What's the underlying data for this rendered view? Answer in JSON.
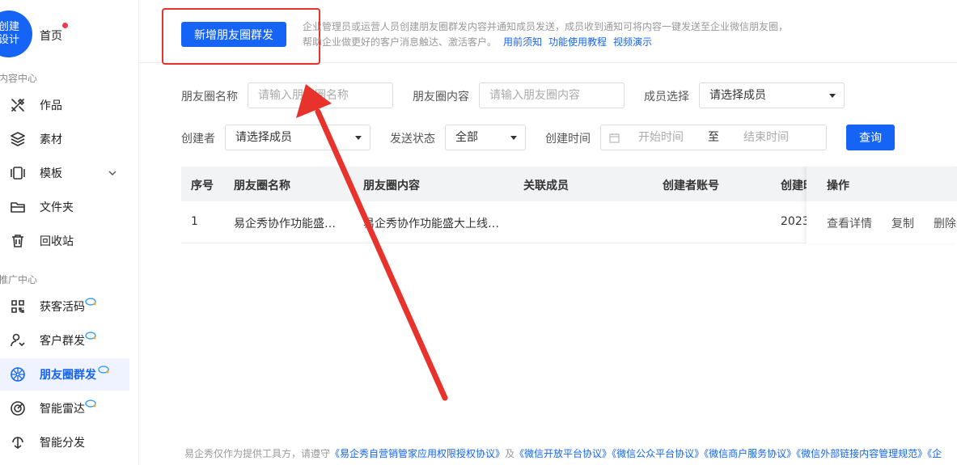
{
  "sidebar": {
    "logo_text": "创建\n设计",
    "home_label": "首页",
    "section_content": "内容中心",
    "section_promo": "推广中心",
    "items": [
      {
        "label": "作品",
        "icon": "tools-icon"
      },
      {
        "label": "素材",
        "icon": "layers-icon"
      },
      {
        "label": "模板",
        "icon": "template-icon"
      },
      {
        "label": "文件夹",
        "icon": "folder-icon"
      },
      {
        "label": "回收站",
        "icon": "trash-icon"
      },
      {
        "label": "获客活码",
        "icon": "qrcode-icon"
      },
      {
        "label": "客户群发",
        "icon": "user-broadcast-icon"
      },
      {
        "label": "朋友圈群发",
        "icon": "moments-icon"
      },
      {
        "label": "智能雷达",
        "icon": "radar-icon"
      },
      {
        "label": "智能分发",
        "icon": "distribute-icon"
      }
    ],
    "active_item": "朋友圈群发"
  },
  "topbar": {
    "add_button": "新增朋友圈群发",
    "desc_line1": "企业管理员或运营人员创建朋友圈群发内容并通知成员发送，成员收到通知可将内容一键发送至企业微信朋友圈，",
    "desc_line2": "帮助企业做更好的客户消息触达、激活客户。",
    "link1": "用前须知",
    "link2": "功能使用教程",
    "link3": "视频演示"
  },
  "filters": {
    "name_label": "朋友圈名称",
    "name_placeholder": "请输入朋友圈名称",
    "content_label": "朋友圈内容",
    "content_placeholder": "请输入朋友圈内容",
    "member_label": "成员选择",
    "member_value": "请选择成员",
    "creator_label": "创建者",
    "creator_value": "请选择成员",
    "status_label": "发送状态",
    "status_value": "全部",
    "time_label": "创建时间",
    "start_placeholder": "开始时间",
    "to_text": "至",
    "end_placeholder": "结束时间",
    "query_button": "查询"
  },
  "table": {
    "headers": [
      "序号",
      "朋友圈名称",
      "朋友圈内容",
      "关联成员",
      "创建者账号",
      "创建时",
      "操作"
    ],
    "rows": [
      {
        "index": "1",
        "name": "易企秀协作功能盛…",
        "content": "易企秀协作功能盛大上线…",
        "member": " ",
        "creator": "",
        "created": "2023",
        "ops": [
          "查看详情",
          "复制",
          "删除"
        ]
      }
    ]
  },
  "footer": {
    "prefix": "易企秀仅作为提供工具方，请遵守",
    "link1": "《易企秀自营销管家应用权限授权协议》",
    "and": "及",
    "link2": "《微信开放平台协议》",
    "link3": "《微信公众平台协议》",
    "link4": "《微信商户服务协议》",
    "link5": "《微信外部链接内容管理规范》",
    "link6": "《企"
  },
  "colors": {
    "accent": "#1564f5",
    "annotation_red": "#e8322c",
    "active_bg": "#eef3ff"
  }
}
